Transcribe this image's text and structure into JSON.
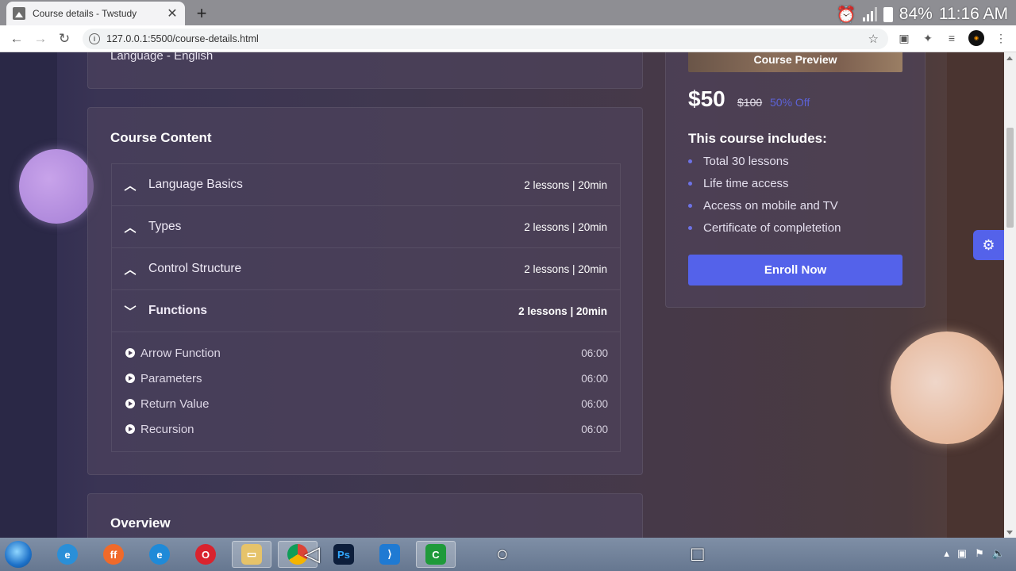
{
  "browser": {
    "tab_title": "Course details - Twstudy",
    "url": "127.0.0.1:5500/course-details.html"
  },
  "device_status": {
    "battery": "84%",
    "time": "11:16 AM"
  },
  "course": {
    "language_line": "Language -  English",
    "content_title": "Course Content",
    "sections": [
      {
        "title": "Language Basics",
        "meta": "2 lessons | 20min",
        "expanded": false
      },
      {
        "title": "Types",
        "meta": "2 lessons | 20min",
        "expanded": false
      },
      {
        "title": "Control Structure",
        "meta": "2 lessons | 20min",
        "expanded": false
      },
      {
        "title": "Functions",
        "meta": "2 lessons | 20min",
        "expanded": true
      }
    ],
    "lessons": [
      {
        "name": "Arrow Function",
        "time": "06:00"
      },
      {
        "name": "Parameters",
        "time": "06:00"
      },
      {
        "name": "Return Value",
        "time": "06:00"
      },
      {
        "name": "Recursion",
        "time": "06:00"
      }
    ],
    "overview_title": "Overview"
  },
  "sidebar": {
    "preview_label": "Course Preview",
    "price_now": "$50",
    "price_old": "$100",
    "discount": "50% Off",
    "includes_title": "This course includes:",
    "includes": [
      "Total 30 lessons",
      "Life time access",
      "Access on mobile and TV",
      "Certificate of completetion"
    ],
    "enroll_label": "Enroll Now"
  },
  "colors": {
    "accent": "#5462ea",
    "bubble_left": "#b38fe0",
    "bubble_right": "#e7b89a"
  }
}
